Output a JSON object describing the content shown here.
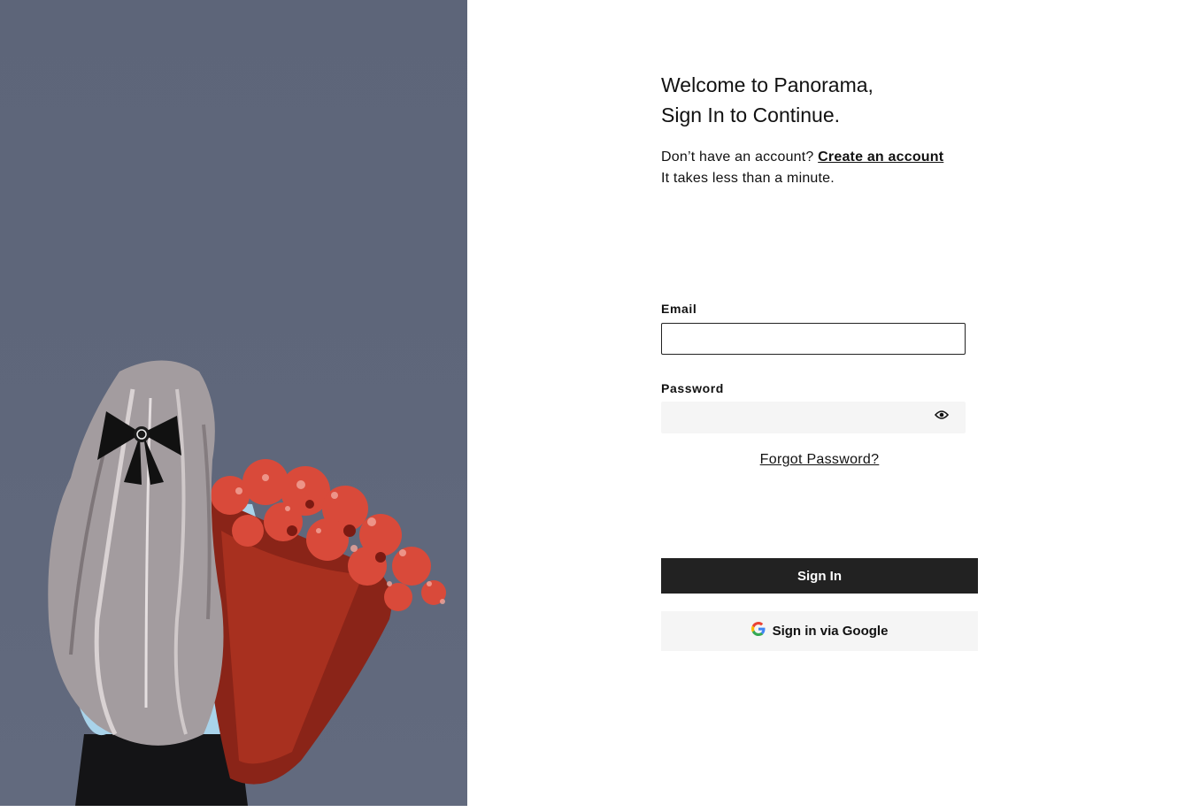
{
  "hero": {
    "illustration": "woman-with-flower-bouquet-illustration",
    "background_color": "#5f677b"
  },
  "header": {
    "title_line1": "Welcome to Panorama,",
    "title_line2": "Sign In to Continue."
  },
  "signup_prompt": {
    "text": "Don’t have an account? ",
    "link_label": "Create an account",
    "note": "It takes less than a minute."
  },
  "form": {
    "email_label": "Email",
    "email_value": "",
    "password_label": "Password",
    "password_value": "",
    "toggle_icon": "eye-icon",
    "forgot_label": "Forgot Password?"
  },
  "actions": {
    "signin_label": "Sign In",
    "google_label": "Sign in via Google",
    "google_icon": "google-g-icon"
  },
  "colors": {
    "primary_button": "#222222",
    "secondary_button": "#f5f5f5",
    "hero_bg": "#5f677b"
  }
}
